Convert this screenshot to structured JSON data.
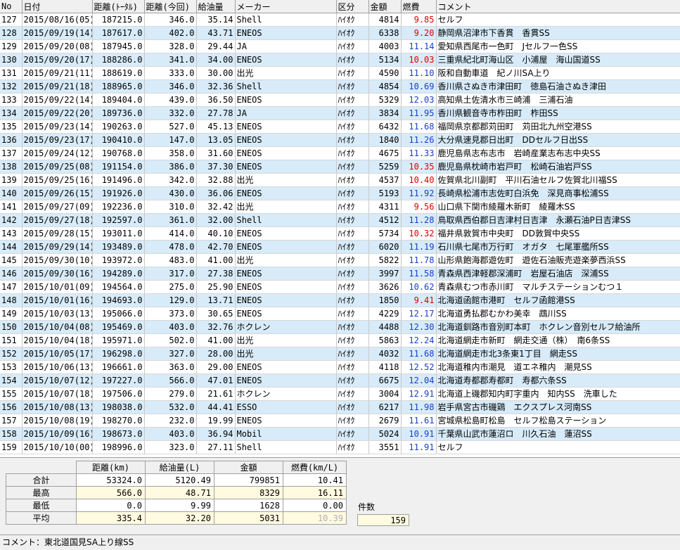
{
  "columns": [
    "No",
    "日付",
    "距離(ﾄｰﾀﾙ)",
    "距離(今回)",
    "給油量",
    "メーカー",
    "区分",
    "金額",
    "燃費",
    "コメント"
  ],
  "rows": [
    {
      "no": "127",
      "date": "2015/08/16(05)",
      "total": "187215.0",
      "trip": "346.0",
      "fuel": "35.14",
      "maker": "Shell",
      "kind": "ﾊｲｵｸ",
      "amount": "4814",
      "mpg": "9.85",
      "mpg_color": "red",
      "comment": "セルフ"
    },
    {
      "no": "128",
      "date": "2015/09/19(14)",
      "total": "187617.0",
      "trip": "402.0",
      "fuel": "43.71",
      "maker": "ENEOS",
      "kind": "ﾊｲｵｸ",
      "amount": "6338",
      "mpg": "9.20",
      "mpg_color": "red",
      "comment": "静岡県沼津市下香貫　香貫SS"
    },
    {
      "no": "129",
      "date": "2015/09/20(08)",
      "total": "187945.0",
      "trip": "328.0",
      "fuel": "29.44",
      "maker": "JA",
      "kind": "ﾊｲｵｸ",
      "amount": "4003",
      "mpg": "11.14",
      "mpg_color": "blue",
      "comment": "愛知県西尾市一色町　Jセルフ一色SS"
    },
    {
      "no": "130",
      "date": "2015/09/20(17)",
      "total": "188286.0",
      "trip": "341.0",
      "fuel": "34.00",
      "maker": "ENEOS",
      "kind": "ﾊｲｵｸ",
      "amount": "5134",
      "mpg": "10.03",
      "mpg_color": "red",
      "comment": "三重県紀北町海山区　小浦屋　海山国道SS"
    },
    {
      "no": "131",
      "date": "2015/09/21(11)",
      "total": "188619.0",
      "trip": "333.0",
      "fuel": "30.00",
      "maker": "出光",
      "kind": "ﾊｲｵｸ",
      "amount": "4590",
      "mpg": "11.10",
      "mpg_color": "blue",
      "comment": "阪和自動車道　紀ノ川SA上り"
    },
    {
      "no": "132",
      "date": "2015/09/21(18)",
      "total": "188965.0",
      "trip": "346.0",
      "fuel": "32.36",
      "maker": "Shell",
      "kind": "ﾊｲｵｸ",
      "amount": "4854",
      "mpg": "10.69",
      "mpg_color": "blue",
      "comment": "香川県さぬき市津田町　徳島石油さぬき津田"
    },
    {
      "no": "133",
      "date": "2015/09/22(14)",
      "total": "189404.0",
      "trip": "439.0",
      "fuel": "36.50",
      "maker": "ENEOS",
      "kind": "ﾊｲｵｸ",
      "amount": "5329",
      "mpg": "12.03",
      "mpg_color": "blue",
      "comment": "高知県土佐清水市三崎浦　三浦石油"
    },
    {
      "no": "134",
      "date": "2015/09/22(20)",
      "total": "189736.0",
      "trip": "332.0",
      "fuel": "27.78",
      "maker": "JA",
      "kind": "ﾊｲｵｸ",
      "amount": "3834",
      "mpg": "11.95",
      "mpg_color": "blue",
      "comment": "香川県観音寺市柞田町　柞田SS"
    },
    {
      "no": "135",
      "date": "2015/09/23(14)",
      "total": "190263.0",
      "trip": "527.0",
      "fuel": "45.13",
      "maker": "ENEOS",
      "kind": "ﾊｲｵｸ",
      "amount": "6432",
      "mpg": "11.68",
      "mpg_color": "blue",
      "comment": "福岡県京都郡苅田町　苅田北九州空港SS"
    },
    {
      "no": "136",
      "date": "2015/09/23(17)",
      "total": "190410.0",
      "trip": "147.0",
      "fuel": "13.05",
      "maker": "ENEOS",
      "kind": "ﾊｲｵｸ",
      "amount": "1840",
      "mpg": "11.26",
      "mpg_color": "blue",
      "comment": "大分県速見郡日出町　DDセルフ日出SS"
    },
    {
      "no": "137",
      "date": "2015/09/24(12)",
      "total": "190768.0",
      "trip": "358.0",
      "fuel": "31.60",
      "maker": "ENEOS",
      "kind": "ﾊｲｵｸ",
      "amount": "4675",
      "mpg": "11.33",
      "mpg_color": "blue",
      "comment": "鹿児島県志布志市　岩崎産業志布志中央SS"
    },
    {
      "no": "138",
      "date": "2015/09/25(08)",
      "total": "191154.0",
      "trip": "386.0",
      "fuel": "37.30",
      "maker": "ENEOS",
      "kind": "ﾊｲｵｸ",
      "amount": "5259",
      "mpg": "10.35",
      "mpg_color": "red",
      "comment": "鹿児島県枕崎市岩戸町　松崎石油岩戸SS"
    },
    {
      "no": "139",
      "date": "2015/09/25(16)",
      "total": "191496.0",
      "trip": "342.0",
      "fuel": "32.88",
      "maker": "出光",
      "kind": "ﾊｲｵｸ",
      "amount": "4537",
      "mpg": "10.40",
      "mpg_color": "red",
      "comment": "佐賀県北川副町　平川石油セルフ佐賀北川福SS"
    },
    {
      "no": "140",
      "date": "2015/09/26(15)",
      "total": "191926.0",
      "trip": "430.0",
      "fuel": "36.06",
      "maker": "ENEOS",
      "kind": "ﾊｲｵｸ",
      "amount": "5193",
      "mpg": "11.92",
      "mpg_color": "blue",
      "comment": "長崎県松浦市志佐町白浜免　深見商事松浦SS"
    },
    {
      "no": "141",
      "date": "2015/09/27(09)",
      "total": "192236.0",
      "trip": "310.0",
      "fuel": "32.42",
      "maker": "出光",
      "kind": "ﾊｲｵｸ",
      "amount": "4311",
      "mpg": "9.56",
      "mpg_color": "red",
      "comment": "山口県下関市綾羅木新町　綾羅木SS"
    },
    {
      "no": "142",
      "date": "2015/09/27(18)",
      "total": "192597.0",
      "trip": "361.0",
      "fuel": "32.00",
      "maker": "Shell",
      "kind": "ﾊｲｵｸ",
      "amount": "4512",
      "mpg": "11.28",
      "mpg_color": "blue",
      "comment": "鳥取県西伯郡日吉津村日吉津　永瀬石油P日吉津SS"
    },
    {
      "no": "143",
      "date": "2015/09/28(15)",
      "total": "193011.0",
      "trip": "414.0",
      "fuel": "40.10",
      "maker": "ENEOS",
      "kind": "ﾊｲｵｸ",
      "amount": "5734",
      "mpg": "10.32",
      "mpg_color": "red",
      "comment": "福井県敦賀市中央町　DD敦賀中央SS"
    },
    {
      "no": "144",
      "date": "2015/09/29(14)",
      "total": "193489.0",
      "trip": "478.0",
      "fuel": "42.70",
      "maker": "ENEOS",
      "kind": "ﾊｲｵｸ",
      "amount": "6020",
      "mpg": "11.19",
      "mpg_color": "blue",
      "comment": "石川県七尾市万行町　オガタ　七尾軍艦所SS"
    },
    {
      "no": "145",
      "date": "2015/09/30(10)",
      "total": "193972.0",
      "trip": "483.0",
      "fuel": "41.00",
      "maker": "出光",
      "kind": "ﾊｲｵｸ",
      "amount": "5822",
      "mpg": "11.78",
      "mpg_color": "blue",
      "comment": "山形県飽海郡遊佐町　遊佐石油販売遊楽夢西浜SS"
    },
    {
      "no": "146",
      "date": "2015/09/30(16)",
      "total": "194289.0",
      "trip": "317.0",
      "fuel": "27.38",
      "maker": "ENEOS",
      "kind": "ﾊｲｵｸ",
      "amount": "3997",
      "mpg": "11.58",
      "mpg_color": "blue",
      "comment": "青森県西津軽郡深浦町　岩屋石油店　深浦SS"
    },
    {
      "no": "147",
      "date": "2015/10/01(09)",
      "total": "194564.0",
      "trip": "275.0",
      "fuel": "25.90",
      "maker": "ENEOS",
      "kind": "ﾊｲｵｸ",
      "amount": "3626",
      "mpg": "10.62",
      "mpg_color": "blue",
      "comment": "青森県むつ市赤川町　マルチステーションむつ１"
    },
    {
      "no": "148",
      "date": "2015/10/01(16)",
      "total": "194693.0",
      "trip": "129.0",
      "fuel": "13.71",
      "maker": "ENEOS",
      "kind": "ﾊｲｵｸ",
      "amount": "1850",
      "mpg": "9.41",
      "mpg_color": "red",
      "comment": "北海道函館市港町　セルフ函館港SS"
    },
    {
      "no": "149",
      "date": "2015/10/03(13)",
      "total": "195066.0",
      "trip": "373.0",
      "fuel": "30.65",
      "maker": "ENEOS",
      "kind": "ﾊｲｵｸ",
      "amount": "4229",
      "mpg": "12.17",
      "mpg_color": "blue",
      "comment": "北海道勇払郡むかわ美幸　鵡川SS"
    },
    {
      "no": "150",
      "date": "2015/10/04(08)",
      "total": "195469.0",
      "trip": "403.0",
      "fuel": "32.76",
      "maker": "ホクレン",
      "kind": "ﾊｲｵｸ",
      "amount": "4488",
      "mpg": "12.30",
      "mpg_color": "blue",
      "comment": "北海道釧路市音別町本町　ホクレン音別セルフ給油所"
    },
    {
      "no": "151",
      "date": "2015/10/04(18)",
      "total": "195971.0",
      "trip": "502.0",
      "fuel": "41.00",
      "maker": "出光",
      "kind": "ﾊｲｵｸ",
      "amount": "5863",
      "mpg": "12.24",
      "mpg_color": "blue",
      "comment": "北海道網走市新町　網走交通（株）　南6条SS"
    },
    {
      "no": "152",
      "date": "2015/10/05(17)",
      "total": "196298.0",
      "trip": "327.0",
      "fuel": "28.00",
      "maker": "出光",
      "kind": "ﾊｲｵｸ",
      "amount": "4032",
      "mpg": "11.68",
      "mpg_color": "blue",
      "comment": "北海道網走市北3条東1丁目　網走SS"
    },
    {
      "no": "153",
      "date": "2015/10/06(13)",
      "total": "196661.0",
      "trip": "363.0",
      "fuel": "29.00",
      "maker": "ENEOS",
      "kind": "ﾊｲｵｸ",
      "amount": "4118",
      "mpg": "12.52",
      "mpg_color": "blue",
      "comment": "北海道稚内市潮見　道エネ稚内　潮見SS"
    },
    {
      "no": "154",
      "date": "2015/10/07(12)",
      "total": "197227.0",
      "trip": "566.0",
      "fuel": "47.01",
      "maker": "ENEOS",
      "kind": "ﾊｲｵｸ",
      "amount": "6675",
      "mpg": "12.04",
      "mpg_color": "blue",
      "comment": "北海道寿都郡寿都町　寿都六条SS"
    },
    {
      "no": "155",
      "date": "2015/10/07(18)",
      "total": "197506.0",
      "trip": "279.0",
      "fuel": "21.61",
      "maker": "ホクレン",
      "kind": "ﾊｲｵｸ",
      "amount": "3004",
      "mpg": "12.91",
      "mpg_color": "blue",
      "comment": "北海道上磯郡知内町字重内　知内SS　洗車した"
    },
    {
      "no": "156",
      "date": "2015/10/08(13)",
      "total": "198038.0",
      "trip": "532.0",
      "fuel": "44.41",
      "maker": "ESSO",
      "kind": "ﾊｲｵｸ",
      "amount": "6217",
      "mpg": "11.98",
      "mpg_color": "blue",
      "comment": "岩手県宮古市磯鶏　エクスプレス河南SS"
    },
    {
      "no": "157",
      "date": "2015/10/08(19)",
      "total": "198270.0",
      "trip": "232.0",
      "fuel": "19.99",
      "maker": "ENEOS",
      "kind": "ﾊｲｵｸ",
      "amount": "2679",
      "mpg": "11.61",
      "mpg_color": "blue",
      "comment": "宮城県松島町松島　セルフ松島ステーション"
    },
    {
      "no": "158",
      "date": "2015/10/09(16)",
      "total": "198673.0",
      "trip": "403.0",
      "fuel": "36.94",
      "maker": "Mobil",
      "kind": "ﾊｲｵｸ",
      "amount": "5024",
      "mpg": "10.91",
      "mpg_color": "blue",
      "comment": "千葉県山武市蓮沼ロ　川久石油　蓮沼SS"
    },
    {
      "no": "159",
      "date": "2015/10/10(00)",
      "total": "198996.0",
      "trip": "323.0",
      "fuel": "27.11",
      "maker": "Shell",
      "kind": "ﾊｲｵｸ",
      "amount": "3551",
      "mpg": "11.91",
      "mpg_color": "blue",
      "comment": "セルフ"
    }
  ],
  "summary": {
    "headers": [
      "距離(km)",
      "給油量(L)",
      "金額",
      "燃費(km/L)"
    ],
    "rows": [
      {
        "label": "合計",
        "values": [
          "53324.0",
          "5120.49",
          "799851",
          "10.41"
        ],
        "highlight": false
      },
      {
        "label": "最高",
        "values": [
          "566.0",
          "48.71",
          "8329",
          "16.11"
        ],
        "highlight": true
      },
      {
        "label": "最低",
        "values": [
          "0.0",
          "9.99",
          "1628",
          "0.00"
        ],
        "highlight": false
      },
      {
        "label": "平均",
        "values": [
          "335.4",
          "32.20",
          "5031",
          "10.39"
        ],
        "highlight": true,
        "dim_last": true
      }
    ]
  },
  "count": {
    "label": "件数",
    "value": "159"
  },
  "status": {
    "text": "コメント：東北道国見SA上り線SS"
  },
  "colors": {
    "alt_row": "#d7ebf9",
    "red": "#e00000",
    "blue": "#1a3fc4",
    "highlight": "#fffae0"
  }
}
